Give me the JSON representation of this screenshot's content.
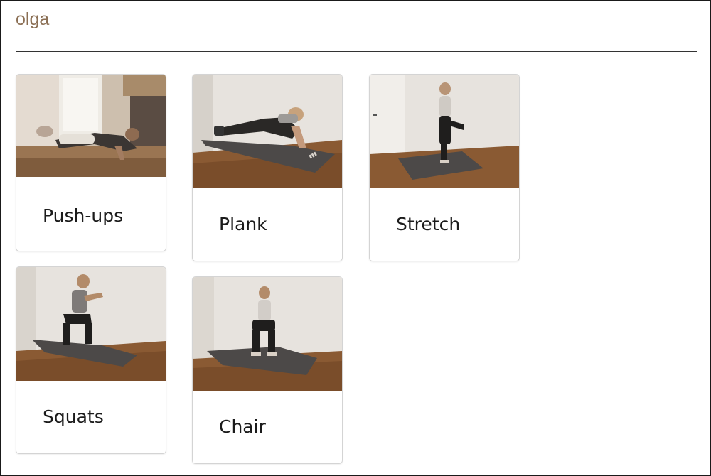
{
  "search": {
    "value": "olga"
  },
  "exercises": [
    {
      "label": "Push-ups"
    },
    {
      "label": "Plank"
    },
    {
      "label": "Stretch"
    },
    {
      "label": "Squats"
    },
    {
      "label": "Chair"
    }
  ],
  "colors": {
    "search_text": "#8a6e53",
    "wall": "#e6e2dd",
    "floor": "#8a5a33",
    "mat": "#4c4948",
    "card_border": "#d4d4d4"
  }
}
